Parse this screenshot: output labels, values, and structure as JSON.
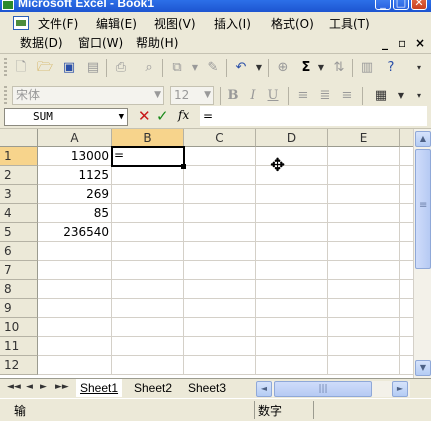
{
  "window": {
    "title": "Microsoft Excel - Book1",
    "minimize_glyph": "_",
    "restore_glyph": "□",
    "close_glyph": "✕"
  },
  "menubar": {
    "items": [
      "文件(F)",
      "编辑(E)",
      "视图(V)",
      "插入(I)",
      "格式(O)",
      "工具(T)",
      "数据(D)",
      "窗口(W)",
      "帮助(H)"
    ],
    "doc_controls": [
      "_",
      "▫",
      "×"
    ]
  },
  "standard_toolbar": {
    "icons": [
      "new-icon",
      "open-icon",
      "save-icon",
      "permission-icon",
      "print-icon",
      "print-preview-icon",
      "research-icon",
      "copy-icon",
      "format-painter-icon",
      "undo-icon",
      "hyperlink-icon",
      "autosum-icon",
      "sort-icon",
      "chart-icon",
      "help-icon"
    ],
    "autosum_label": "Σ"
  },
  "formatting_toolbar": {
    "font": "宋体",
    "size": "12",
    "bold": "B",
    "italic": "I",
    "underline": "U"
  },
  "formula_bar": {
    "name_box": "SUM",
    "fx_label": "fx",
    "content": "="
  },
  "grid": {
    "columns": [
      "A",
      "B",
      "C",
      "D",
      "E"
    ],
    "rows": [
      "1",
      "2",
      "3",
      "4",
      "5",
      "6",
      "7",
      "8",
      "9",
      "10",
      "11",
      "12"
    ],
    "active_cell": "B1",
    "active_cell_text": "=",
    "colA_values": [
      "13000",
      "1125",
      "269",
      "85",
      "236540"
    ]
  },
  "sheet_tabs": {
    "nav": [
      "◄◄",
      "◄",
      "►",
      "►►"
    ],
    "tabs": [
      "Sheet1",
      "Sheet2",
      "Sheet3"
    ]
  },
  "status": {
    "mode": "输",
    "indicator": "数字"
  }
}
